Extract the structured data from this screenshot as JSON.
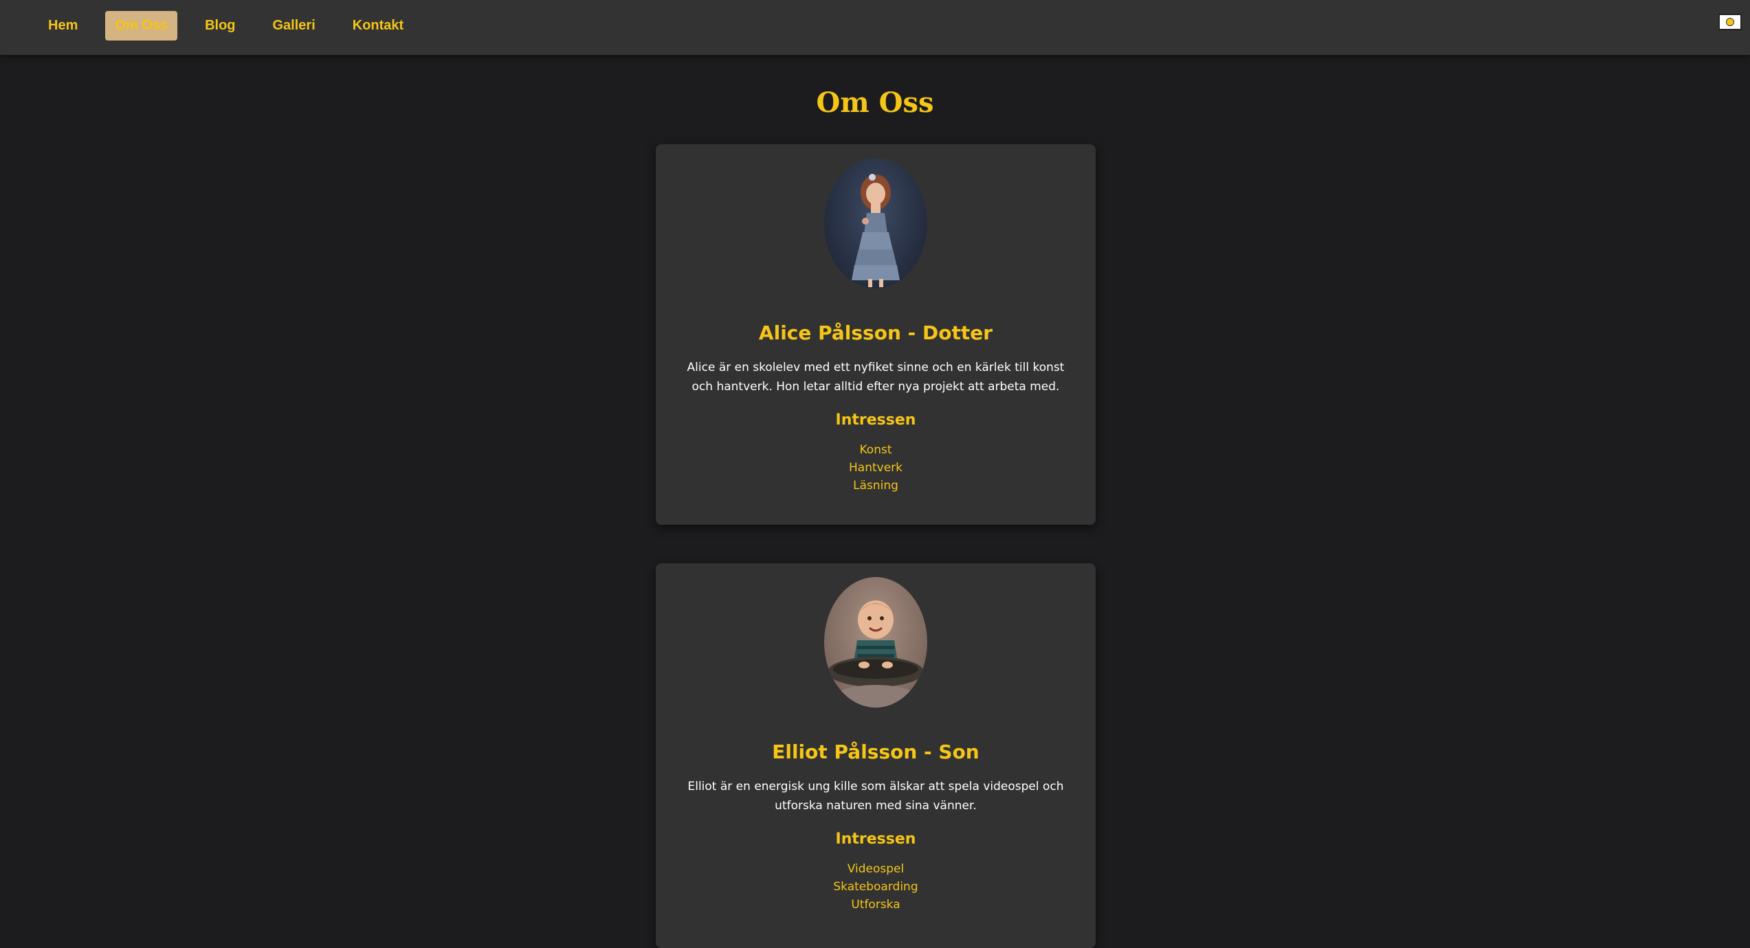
{
  "nav": {
    "items": [
      {
        "label": "Hem"
      },
      {
        "label": "Om Oss"
      },
      {
        "label": "Blog"
      },
      {
        "label": "Galleri"
      },
      {
        "label": "Kontakt"
      }
    ],
    "active_index": 1
  },
  "theme_toggle": {
    "icon": "sun-icon"
  },
  "page": {
    "title": "Om Oss"
  },
  "members": [
    {
      "name": "Alice Pålsson - Dotter",
      "description": "Alice är en skolelev med ett nyfiket sinne och en kärlek till konst och hantverk. Hon letar alltid efter nya projekt att arbeta med.",
      "interests_title": "Intressen",
      "interests": [
        "Konst",
        "Hantverk",
        "Läsning"
      ]
    },
    {
      "name": "Elliot Pålsson - Son",
      "description": "Elliot är en energisk ung kille som älskar att spela videospel och utforska naturen med sina vänner.",
      "interests_title": "Intressen",
      "interests": [
        "Videospel",
        "Skateboarding",
        "Utforska"
      ]
    }
  ],
  "colors": {
    "background": "#1c1c1e",
    "navbar": "#333333",
    "card": "#323232",
    "accent": "#f5c518",
    "active_nav_bg": "#d4b483",
    "text": "#ffffff"
  }
}
